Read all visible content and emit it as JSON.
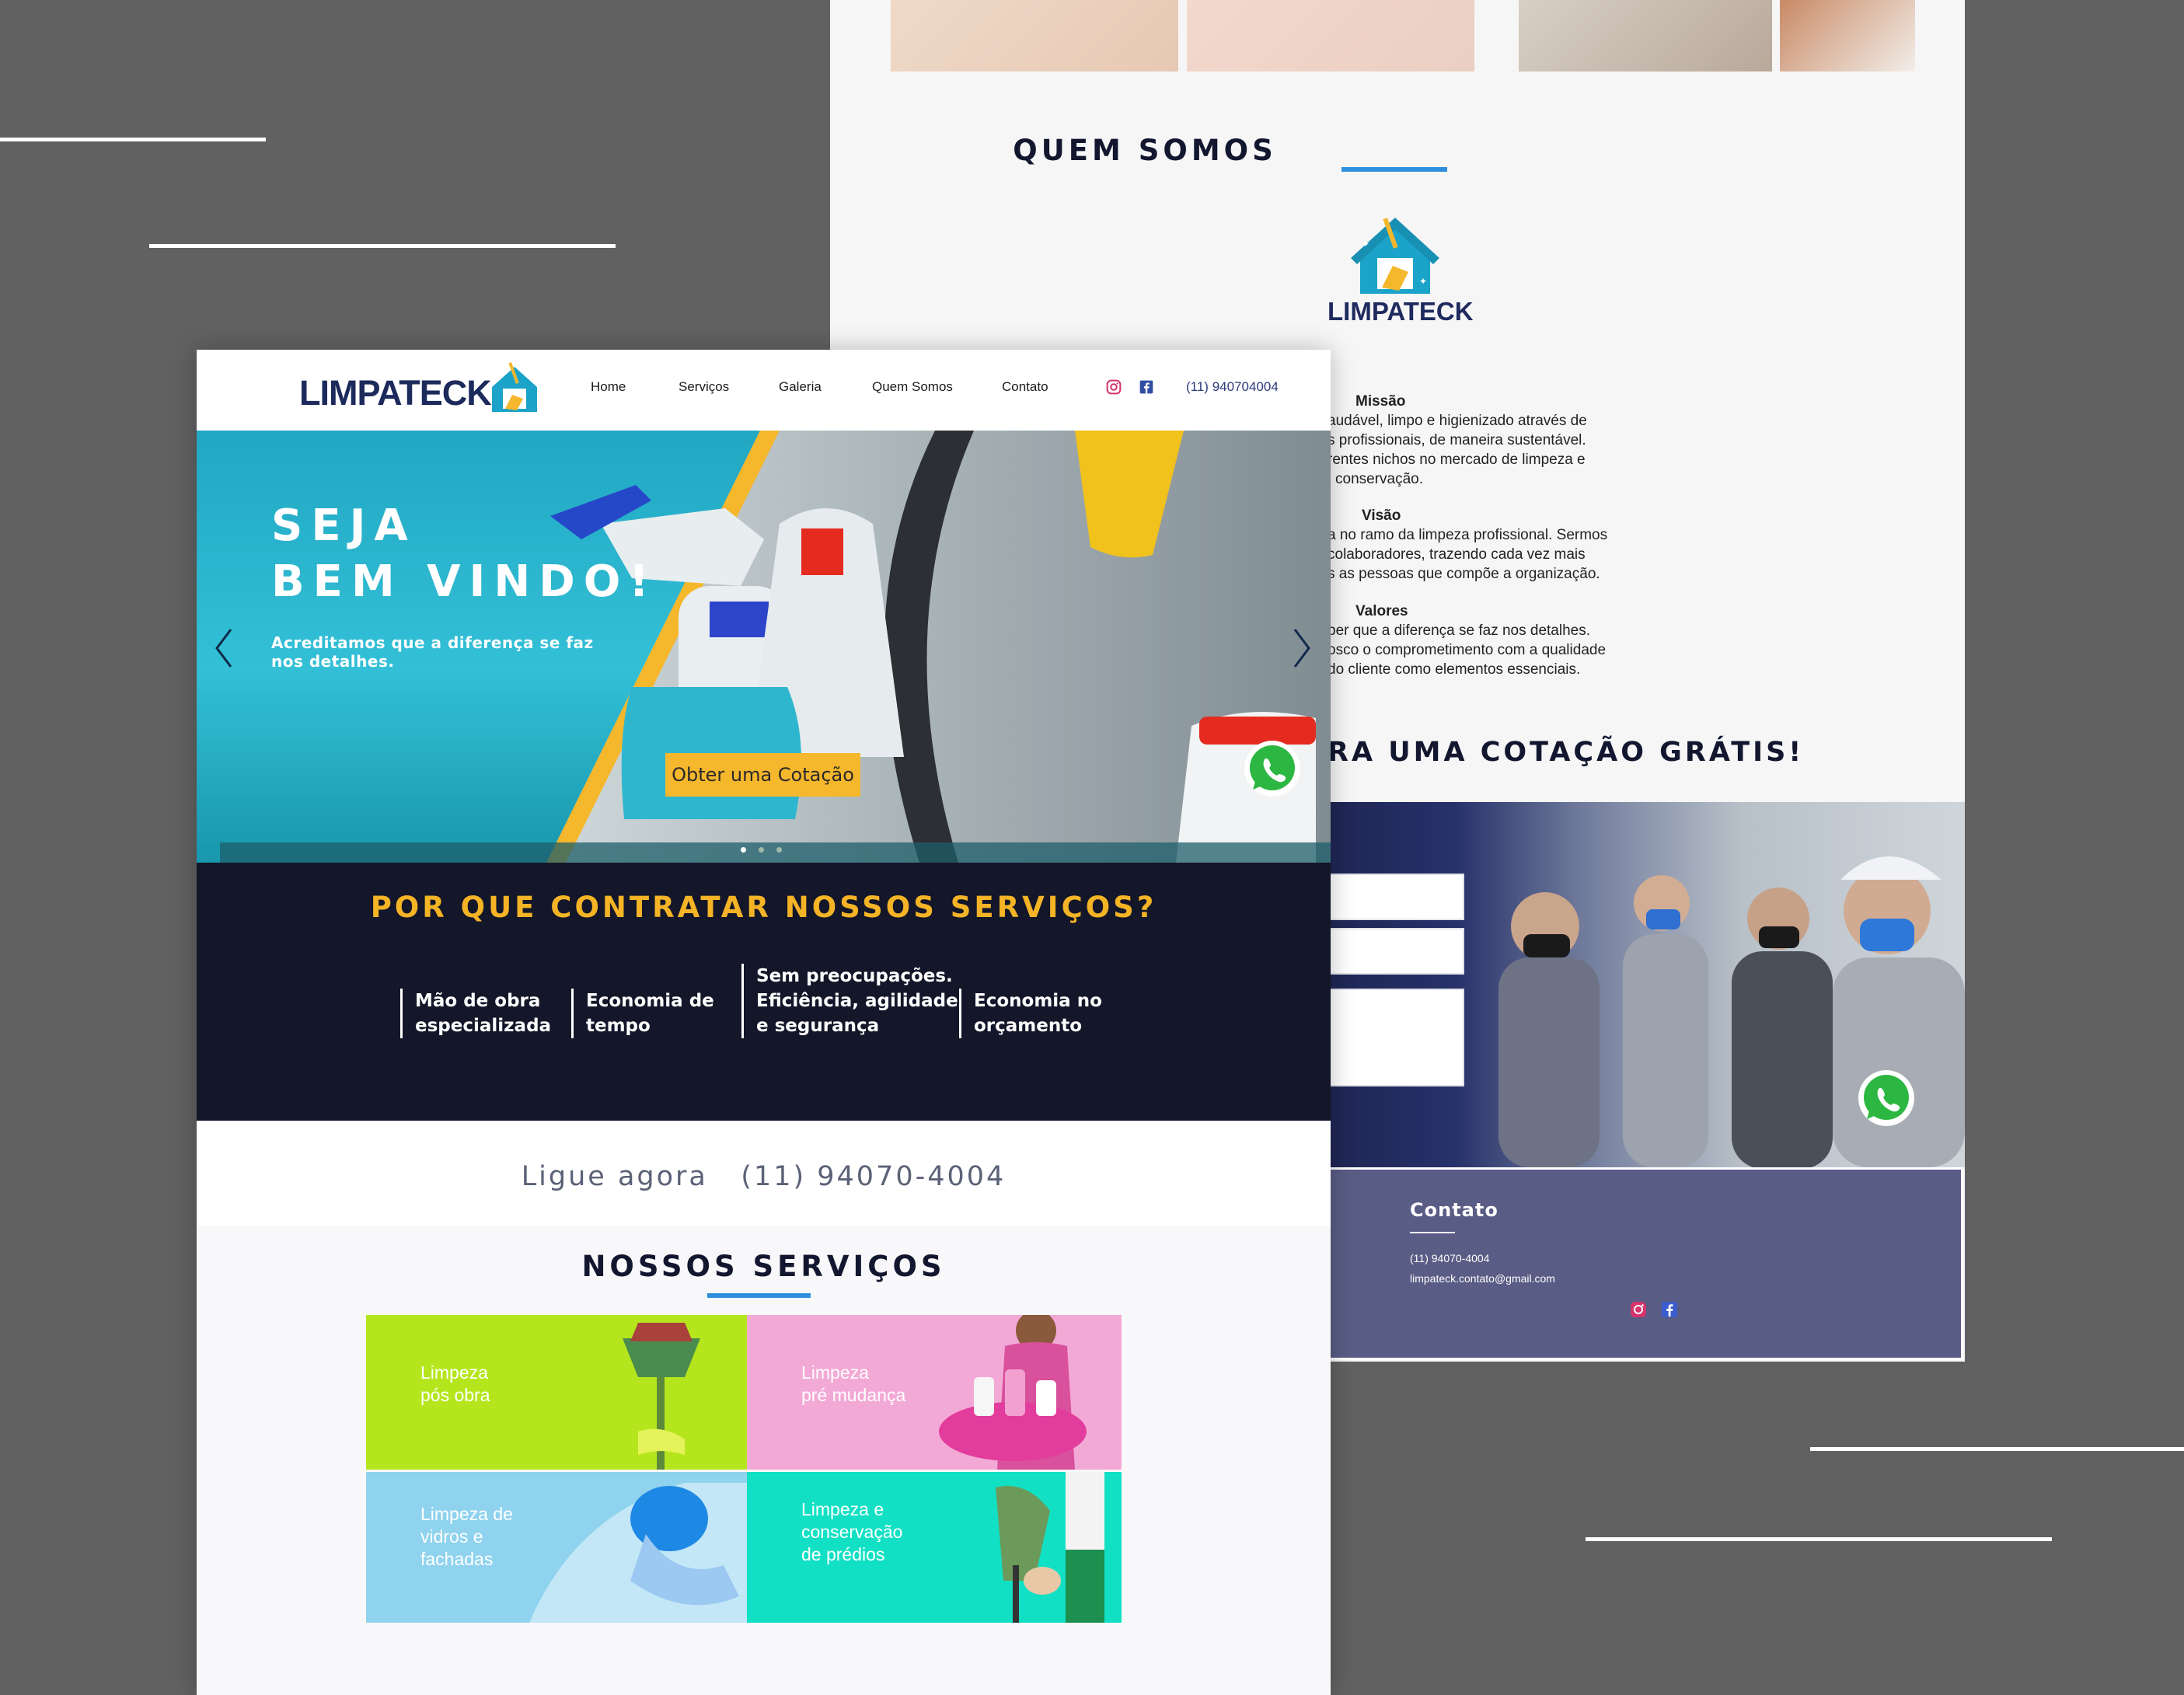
{
  "brand": {
    "name": "LIMPATECK",
    "colors": {
      "navy": "#1c2a5c",
      "accent_yellow": "#f5b72b",
      "accent_blue": "#2f8fdc",
      "dark_band": "#141629"
    }
  },
  "back_page": {
    "about": {
      "title": "QUEM SOMOS",
      "logo_text": "LIMPATECK",
      "mission_title": "Missão",
      "mission_lines": [
        "audável, limpo e higienizado através de",
        "s profissionais, de maneira sustentável.",
        "rentes nichos no mercado de limpeza e",
        "conservação."
      ],
      "vision_title": "Visão",
      "vision_lines": [
        "a no ramo da limpeza profissional. Sermos",
        "colaboradores, trazendo cada vez mais",
        "s as pessoas que compõe a organização."
      ],
      "values_title": "Valores",
      "values_lines": [
        "ber que a diferença se faz nos detalhes.",
        "osco o comprometimento com a qualidade",
        "do cliente como elementos essenciais."
      ]
    },
    "quote_title": "RA UMA COTAÇÃO GRÁTIS!",
    "contact": {
      "title": "Contato",
      "phone": "(11) 94070-4004",
      "email": "limpateck.contato@gmail.com"
    },
    "icons": [
      "instagram-icon",
      "facebook-icon",
      "whatsapp-icon"
    ]
  },
  "front_page": {
    "header": {
      "logo_text": "LIMPATECK",
      "nav": [
        "Home",
        "Serviços",
        "Galeria",
        "Quem Somos",
        "Contato"
      ],
      "phone": "(11) 940704004",
      "icons": [
        "instagram-icon",
        "facebook-icon"
      ]
    },
    "hero": {
      "title_line1": "SEJA",
      "title_line2": "BEM VINDO!",
      "subtitle": "Acreditamos que a diferença se faz nos detalhes.",
      "cta": "Obter uma Cotação",
      "slide_count": 3,
      "active_slide": 1
    },
    "why": {
      "title": "POR QUE CONTRATAR NOSSOS SERVIÇOS?",
      "items": [
        {
          "lines": [
            "Mão de obra",
            "especializada"
          ]
        },
        {
          "lines": [
            "Economia de",
            "tempo"
          ]
        },
        {
          "lines": [
            "Sem preocupações.",
            "Eficiência, agilidade",
            "e segurança"
          ]
        },
        {
          "lines": [
            "Economia no",
            "orçamento"
          ]
        }
      ]
    },
    "call": {
      "label": "Ligue agora",
      "phone": "(11) 94070-4004"
    },
    "services": {
      "title": "NOSSOS SERVIÇOS",
      "tiles": [
        {
          "label": "Limpeza\npós obra",
          "color": "#b5e61d"
        },
        {
          "label": "Limpeza\npré mudança",
          "color": "#f3a9d6"
        },
        {
          "label": "Limpeza de\nvidros e\nfachadas",
          "color": "#8fd3ee"
        },
        {
          "label": "Limpeza e\nconservação\nde prédios",
          "color": "#12e0c4"
        }
      ]
    }
  }
}
